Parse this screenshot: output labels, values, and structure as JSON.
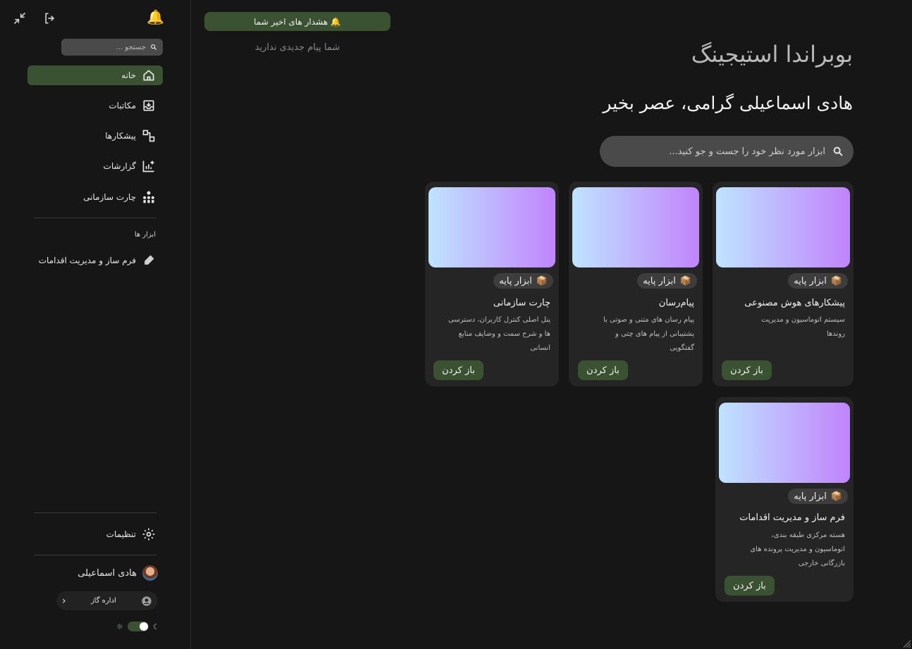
{
  "sidebar": {
    "search_placeholder": "جستجو ...",
    "nav": [
      {
        "label": "خانه",
        "icon": "home-icon"
      },
      {
        "label": "مکاتبات",
        "icon": "inbox-icon"
      },
      {
        "label": "پیشکارها",
        "icon": "workflow-icon"
      },
      {
        "label": "گزارشات",
        "icon": "report-chart-icon"
      },
      {
        "label": "چارت سازمانی",
        "icon": "org-chart-icon"
      }
    ],
    "tools_section_label": "ابزار ها",
    "tools": [
      {
        "label": "فرم ساز و مدیریت اقدامات",
        "icon": "pen-icon"
      }
    ],
    "settings_label": "تنظیمات",
    "user_name": "هادی اسماعیلی",
    "org_name": "اداره گاز"
  },
  "alerts": {
    "title": "هشدار های اخیر شما",
    "empty_message": "شما پیام جدیدی ندارید"
  },
  "header": {
    "brand": "بوبراندا استیجینگ",
    "greeting": "هادی اسماعیلی گرامی، عصر بخیر",
    "search_placeholder": "ابزار مورد نظر خود را جست و جو کنید..."
  },
  "cards": [
    {
      "badge": "ابزار پایه",
      "title": "پیشکارهای هوش مصنوعی",
      "desc": [
        "سیستم اتوماسیون و مدیریت",
        "روندها"
      ],
      "button": "باز کردن"
    },
    {
      "badge": "ابزار پایه",
      "title": "پیام‌رسان",
      "desc": [
        "پیام رسان های متنی و صوتی با",
        "پشتیبانی از پیام های چتی و",
        "گفتگویی"
      ],
      "button": "باز کردن"
    },
    {
      "badge": "ابزار پایه",
      "title": "چارت سازمانی",
      "desc": [
        "پنل اصلی کنترل کاربران، دسترسی",
        "ها و شرح سمت و وضایف منابع",
        "انسانی"
      ],
      "button": "باز کردن"
    },
    {
      "badge": "ابزار پایه",
      "title": "فرم ساز و مدیریت اقدامات",
      "desc": [
        "هسته مرکزی طبقه بندی،",
        "اتوماسیون و مدیریت پرونده های",
        "بازرگانی خارجی"
      ],
      "button": "باز کردن"
    }
  ],
  "colors": {
    "accent": "#3b5232",
    "background": "#161616",
    "card": "#252525"
  }
}
